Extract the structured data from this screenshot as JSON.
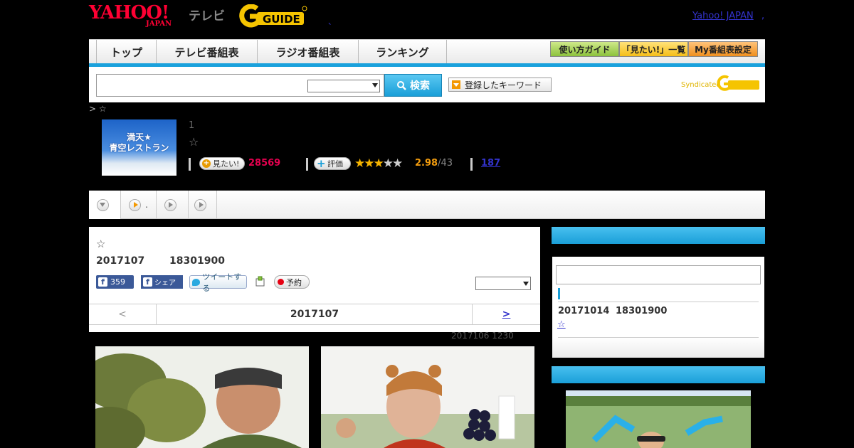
{
  "header": {
    "logo_yahoo": "YAHOO!",
    "logo_japan": "JAPAN",
    "logo_tv": "テレビ",
    "logo_gguide": "G-GUIDE",
    "yahoo_japan_link": "Yahoo! JAPAN",
    "dot": ",",
    "dot2": "、"
  },
  "nav": {
    "tabs": [
      {
        "label": "トップ"
      },
      {
        "label": "テレビ番組表"
      },
      {
        "label": "ラジオ番組表"
      },
      {
        "label": "ランキング"
      }
    ],
    "guide_buttons": [
      {
        "label": "使い方ガイド"
      },
      {
        "label": "「見たい!」一覧"
      },
      {
        "label": "My番組表設定"
      }
    ]
  },
  "search": {
    "placeholder": "",
    "button_label": "検索",
    "keyword_button": "登録したキーワード",
    "syndicated": "Syndicated"
  },
  "breadcrumb": "> ☆",
  "program": {
    "thumb_text_line1": "満天★",
    "thumb_text_line2": "青空レストラン",
    "number": "1",
    "star": "☆",
    "mitai_label": "見たい!",
    "mitai_count": "28569",
    "rate_label": "評価",
    "rating_value": 2.5,
    "score": "2.98",
    "score_total": "/43",
    "count_link": "187"
  },
  "subtabs": [
    {
      "label": ""
    },
    {
      "label": "."
    },
    {
      "label": ""
    },
    {
      "label": ""
    }
  ],
  "episode": {
    "star": "☆",
    "date": "2017107",
    "time": "18301900",
    "like_count": "359",
    "share_label": "シェア",
    "tweet_label": "ツイートする",
    "reserve_label": "予約",
    "pager_prev": "<",
    "pager_current": "2017107",
    "pager_next": ">",
    "updated": "2017106  1230"
  },
  "sidebar": {
    "next_date": "20171014",
    "next_time": "18301900",
    "star_link": "☆"
  },
  "colors": {
    "accent": "#1aa1dc",
    "yahoo_red": "#ff0033",
    "pink_count": "#e5004f",
    "orange_score": "#f29c0e",
    "link": "#3333cc"
  }
}
